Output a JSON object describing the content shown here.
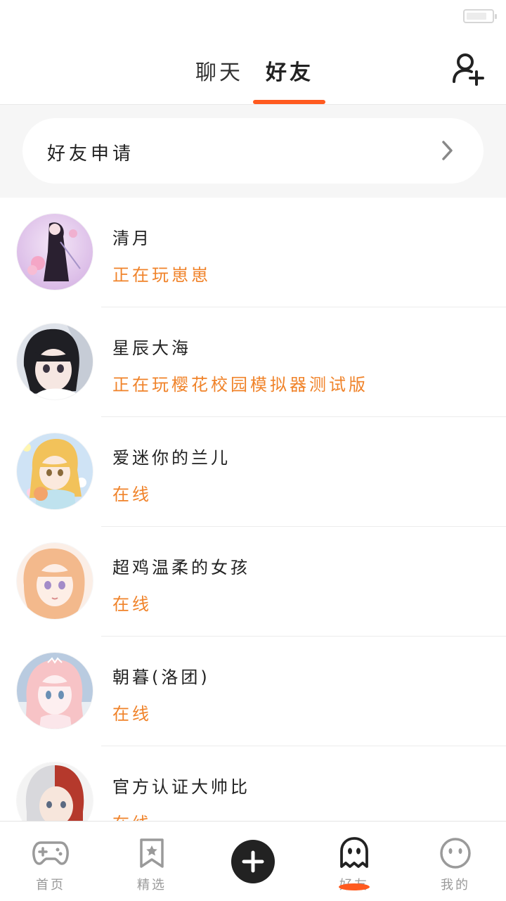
{
  "header": {
    "tabs": [
      {
        "label": "聊天",
        "active": false
      },
      {
        "label": "好友",
        "active": true
      }
    ],
    "accent_color": "#ff5a1f",
    "add_friend_icon": "add-user-icon"
  },
  "friend_request": {
    "label": "好友申请",
    "chevron_icon": "chevron-right-icon"
  },
  "friends": [
    {
      "name": "清月",
      "status": "正在玩崽崽"
    },
    {
      "name": "星辰大海",
      "status": "正在玩樱花校园模拟器测试版"
    },
    {
      "name": "爱迷你的兰儿",
      "status": "在线"
    },
    {
      "name": "超鸡温柔的女孩",
      "status": "在线"
    },
    {
      "name": "朝暮(洛团)",
      "status": "在线"
    },
    {
      "name": "官方认证大帅比",
      "status": "在线"
    }
  ],
  "status_color": "#f0832a",
  "bottom_nav": [
    {
      "label": "首页",
      "icon": "gamepad-icon"
    },
    {
      "label": "精选",
      "icon": "bookmark-star-icon"
    },
    {
      "label": "",
      "icon": "plus-icon"
    },
    {
      "label": "好友",
      "icon": "ghost-icon",
      "active": true
    },
    {
      "label": "我的",
      "icon": "smiley-face-icon"
    }
  ]
}
